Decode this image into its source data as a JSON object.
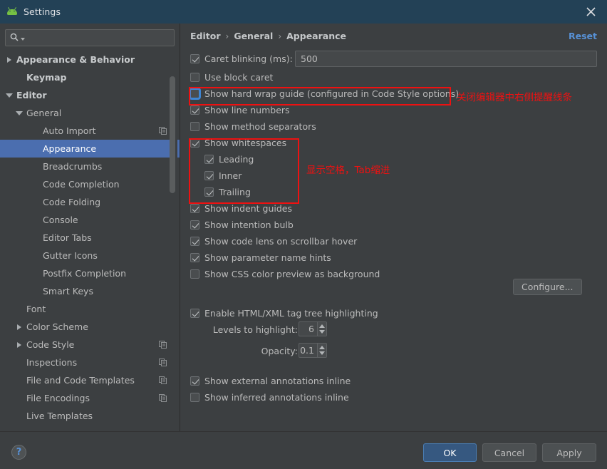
{
  "window": {
    "title": "Settings",
    "app_icon": "android-robot-icon",
    "close_icon": "close-icon"
  },
  "sidebar": {
    "search": {
      "placeholder": "",
      "value": "",
      "icon": "search-icon"
    },
    "items": [
      {
        "label": "Appearance & Behavior",
        "twisty": "right",
        "indent": 0,
        "bold": true,
        "selected": false,
        "copy": false
      },
      {
        "label": "Keymap",
        "twisty": "none",
        "indent": 1,
        "bold": true,
        "selected": false,
        "copy": false
      },
      {
        "label": "Editor",
        "twisty": "down",
        "indent": 0,
        "bold": true,
        "selected": false,
        "copy": false
      },
      {
        "label": "General",
        "twisty": "down",
        "indent": 1,
        "bold": false,
        "selected": false,
        "copy": false
      },
      {
        "label": "Auto Import",
        "twisty": "none",
        "indent": 2,
        "bold": false,
        "selected": false,
        "copy": true
      },
      {
        "label": "Appearance",
        "twisty": "none",
        "indent": 2,
        "bold": false,
        "selected": true,
        "copy": false
      },
      {
        "label": "Breadcrumbs",
        "twisty": "none",
        "indent": 2,
        "bold": false,
        "selected": false,
        "copy": false
      },
      {
        "label": "Code Completion",
        "twisty": "none",
        "indent": 2,
        "bold": false,
        "selected": false,
        "copy": false
      },
      {
        "label": "Code Folding",
        "twisty": "none",
        "indent": 2,
        "bold": false,
        "selected": false,
        "copy": false
      },
      {
        "label": "Console",
        "twisty": "none",
        "indent": 2,
        "bold": false,
        "selected": false,
        "copy": false
      },
      {
        "label": "Editor Tabs",
        "twisty": "none",
        "indent": 2,
        "bold": false,
        "selected": false,
        "copy": false
      },
      {
        "label": "Gutter Icons",
        "twisty": "none",
        "indent": 2,
        "bold": false,
        "selected": false,
        "copy": false
      },
      {
        "label": "Postfix Completion",
        "twisty": "none",
        "indent": 2,
        "bold": false,
        "selected": false,
        "copy": false
      },
      {
        "label": "Smart Keys",
        "twisty": "none",
        "indent": 2,
        "bold": false,
        "selected": false,
        "copy": false
      },
      {
        "label": "Font",
        "twisty": "none",
        "indent": 1,
        "bold": false,
        "selected": false,
        "copy": false
      },
      {
        "label": "Color Scheme",
        "twisty": "right",
        "indent": 1,
        "bold": false,
        "selected": false,
        "copy": false
      },
      {
        "label": "Code Style",
        "twisty": "right",
        "indent": 1,
        "bold": false,
        "selected": false,
        "copy": true
      },
      {
        "label": "Inspections",
        "twisty": "none",
        "indent": 1,
        "bold": false,
        "selected": false,
        "copy": true
      },
      {
        "label": "File and Code Templates",
        "twisty": "none",
        "indent": 1,
        "bold": false,
        "selected": false,
        "copy": true
      },
      {
        "label": "File Encodings",
        "twisty": "none",
        "indent": 1,
        "bold": false,
        "selected": false,
        "copy": true
      },
      {
        "label": "Live Templates",
        "twisty": "none",
        "indent": 1,
        "bold": false,
        "selected": false,
        "copy": false
      }
    ]
  },
  "main": {
    "breadcrumb": [
      "Editor",
      "General",
      "Appearance"
    ],
    "breadcrumb_separator": "›",
    "reset_label": "Reset",
    "caret_blinking": {
      "label": "Caret blinking (ms):",
      "checked": true,
      "value": "500"
    },
    "options": [
      {
        "label": "Use block caret",
        "checked": false,
        "indent": 0,
        "focused": false
      },
      {
        "label": "Show hard wrap guide (configured in Code Style options)",
        "checked": false,
        "indent": 0,
        "focused": true
      },
      {
        "label": "Show line numbers",
        "checked": true,
        "indent": 0,
        "focused": false
      },
      {
        "label": "Show method separators",
        "checked": false,
        "indent": 0,
        "focused": false
      },
      {
        "label": "Show whitespaces",
        "checked": true,
        "indent": 0,
        "focused": false
      },
      {
        "label": "Leading",
        "checked": true,
        "indent": 1,
        "focused": false
      },
      {
        "label": "Inner",
        "checked": true,
        "indent": 1,
        "focused": false
      },
      {
        "label": "Trailing",
        "checked": true,
        "indent": 1,
        "focused": false
      },
      {
        "label": "Show indent guides",
        "checked": true,
        "indent": 0,
        "focused": false
      },
      {
        "label": "Show intention bulb",
        "checked": true,
        "indent": 0,
        "focused": false
      },
      {
        "label": "Show code lens on scrollbar hover",
        "checked": true,
        "indent": 0,
        "focused": false
      },
      {
        "label": "Show parameter name hints",
        "checked": true,
        "indent": 0,
        "focused": false
      },
      {
        "label": "Show CSS color preview as background",
        "checked": false,
        "indent": 0,
        "focused": false
      }
    ],
    "configure_label": "Configure...",
    "html_xml": {
      "label": "Enable HTML/XML tag tree highlighting",
      "checked": true
    },
    "levels": {
      "label": "Levels to highlight:",
      "value": "6"
    },
    "opacity": {
      "label": "Opacity:",
      "value": "0.1"
    },
    "annotations_options": [
      {
        "label": "Show external annotations inline",
        "checked": true
      },
      {
        "label": "Show inferred annotations inline",
        "checked": false
      }
    ]
  },
  "annotations": {
    "hard_wrap_note": "关闭编辑器中右侧提醒线条",
    "whitespace_note": "显示空格，Tab缩进",
    "color": "#ee1111"
  },
  "footer": {
    "help_label": "?",
    "ok_label": "OK",
    "cancel_label": "Cancel",
    "apply_label": "Apply"
  },
  "theme": {
    "titlebar_bg": "#234156",
    "panel_bg": "#3c3f41",
    "selection_bg": "#4b6eaf",
    "link_color": "#5791d6",
    "primary_button_bg": "#365880"
  }
}
